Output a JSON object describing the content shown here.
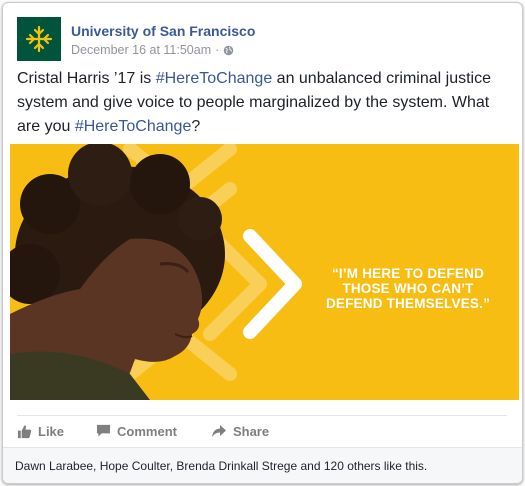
{
  "page": {
    "name": "University of San Francisco",
    "timestamp": "December 16 at 11:50am",
    "separator": "·",
    "brand_color": "#00543c"
  },
  "post": {
    "text_before": "Cristal Harris ’17 is ",
    "hashtag_1": "#HereToChange",
    "text_middle": " an unbalanced criminal justice system and give voice to people marginalized by the system. What are you ",
    "hashtag_2": "#HereToChange",
    "text_after": "?"
  },
  "image": {
    "quote": "“I’M HERE TO DEFEND THOSE WHO CAN’T DEFEND THEMSELVES.”",
    "background_color": "#f7bd12"
  },
  "actions": {
    "like": "Like",
    "comment": "Comment",
    "share": "Share"
  },
  "likes": {
    "text": "Dawn Larabee, Hope Coulter, Brenda Drinkall Strege and 120 others like this."
  }
}
